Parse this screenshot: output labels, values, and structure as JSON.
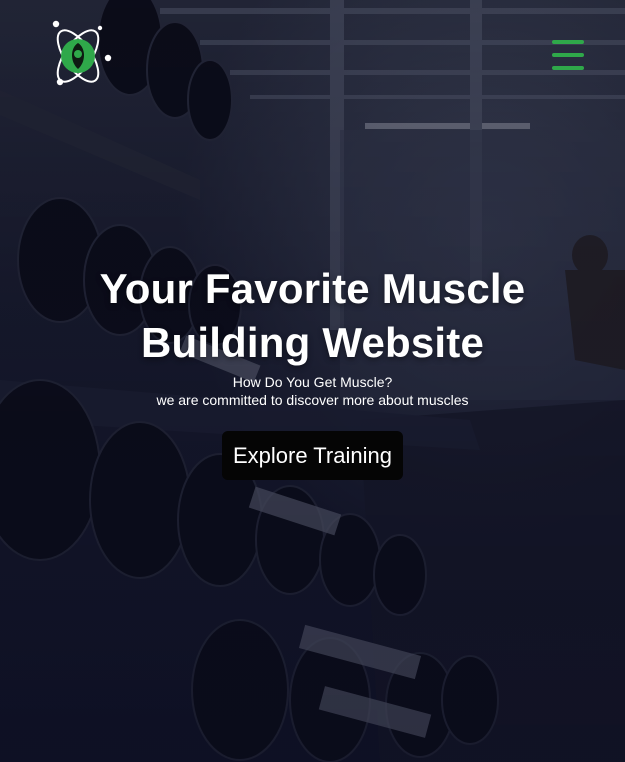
{
  "header": {
    "logo_icon": "atom-leaf-logo-icon",
    "menu_icon": "hamburger-menu-icon"
  },
  "hero": {
    "title": "Your Favorite Muscle Building Website",
    "subtitle_line1": "How Do You Get Muscle?",
    "subtitle_line2": "we are committed to discover more about muscles",
    "cta_label": "Explore Training"
  },
  "colors": {
    "accent": "#2fa84a",
    "button_bg": "#050505",
    "text": "#ffffff",
    "overlay": "#14162a"
  }
}
